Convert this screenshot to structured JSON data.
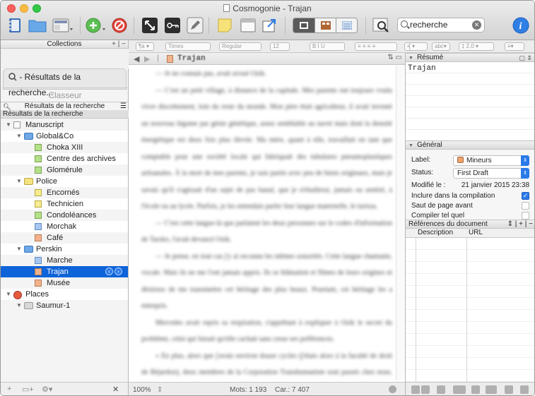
{
  "window": {
    "title": "Cosmogonie - Trajan"
  },
  "toolbar": {
    "search_value": "recherche",
    "icons": [
      "binder-icon",
      "folder-icon",
      "view-mode-icon",
      "add-icon",
      "delete-icon",
      "fullscreen-icon",
      "keywords-icon",
      "compose-icon",
      "note-icon",
      "snapshot-icon",
      "inspector-link-icon",
      "layout-icon",
      "corkboard-icon",
      "outline-icon",
      "search-icon",
      "info-icon"
    ]
  },
  "sidebar": {
    "header": "Collections",
    "collection_search": "- Résultats de la recherche...",
    "collection_binder": "Classeur",
    "filter_label": "Résultats de la recherche",
    "results_header": "Résultats de la recherche",
    "items": [
      {
        "label": "Manuscript",
        "level": 0,
        "icon": "manuscript-icon",
        "open": true
      },
      {
        "label": "Global&Co",
        "level": 1,
        "icon": "folder-blue-icon",
        "open": true
      },
      {
        "label": "Choka XIII",
        "level": 2,
        "icon": "doc-green-icon"
      },
      {
        "label": "Centre des archives",
        "level": 2,
        "icon": "doc-green-icon"
      },
      {
        "label": "Glomérule",
        "level": 2,
        "icon": "doc-green-icon"
      },
      {
        "label": "Police",
        "level": 1,
        "icon": "folder-yellow-icon",
        "open": true
      },
      {
        "label": "Encornés",
        "level": 2,
        "icon": "doc-yellow-icon"
      },
      {
        "label": "Technicien",
        "level": 2,
        "icon": "doc-yellow-icon"
      },
      {
        "label": "Condoléances",
        "level": 2,
        "icon": "doc-green-icon"
      },
      {
        "label": "Morchak",
        "level": 2,
        "icon": "doc-blue-icon"
      },
      {
        "label": "Café",
        "level": 2,
        "icon": "doc-orange-icon"
      },
      {
        "label": "Perskin",
        "level": 1,
        "icon": "folder-blue-icon",
        "open": true
      },
      {
        "label": "Marche",
        "level": 2,
        "icon": "doc-blue-icon"
      },
      {
        "label": "Trajan",
        "level": 2,
        "icon": "doc-orange-icon",
        "selected": true
      },
      {
        "label": "Musée",
        "level": 2,
        "icon": "doc-orange-icon"
      },
      {
        "label": "Places",
        "level": 0,
        "icon": "places-icon",
        "open": true
      },
      {
        "label": "Saumur-1",
        "level": 1,
        "icon": "folder-grey-icon",
        "open": true
      }
    ]
  },
  "editor": {
    "doc_title": "Trajan",
    "zoom": "100%",
    "words": "Mots: 1 193",
    "chars": "Car.: 7 407",
    "paragraphs": [
      "— Je ne connais pas, avait avoué Ozik.",
      "— C'est un petit village, à distance de la capitale. Mes parents ont toujours voulu vivre discrètement, loin du reste du monde. Mon père était agriculteur, il avait inventé un nouveau légume par génie génétique, assez semblable au navet mais dont la densité énergétique est deux fois plus élevée. Ma mère, quant à elle, travaillait en tant que comptable pour une société locale qui fabriquait des tubulures pneumoplastiques artisanales. À la mort de mes parents, je suis partie avec peu de biens originaux, mais je savais qu'il s'agissait d'un sujet de pas banal, que je n'étudierai, jamais ou sentiré, à l'école ou au lycée. Parfois, je les entendais parler leur langue maternelle, le turissa.",
      "— C'est cette langue-là que parlaient les deux personnes sur le codex d'information de Tarsko, l'avait devancé Ozik.",
      "— Je pense, en tout cas j'y ai reconnu les mêmes sonorités. Cette langue chantante, vocale. Mais ils ne me l'ont jamais appris. Ils se blâmaient et filmes de leurs origines ni désireux de me transmettre cet héritage des plus beaux. Pourtant, cet héritage les a entrepris.",
      "Mercedes avait repris sa respiration, s'apprêtant à expliquer à Ozik le secret du problème, celui qui faisait qu'elle cachait sans cesse ses préférences.",
      "« En plus, alors que j'avais environ douze cycles (j'étais alors à la faculté de droit de Béjardon), deux membres de la Corporation Transhumaniste sont passés chez nous. Mes parents avaient l'air moyennement heureux de les voir. J'ai implicitement compris que la"
    ]
  },
  "inspector": {
    "summary_header": "Résumé",
    "summary_text": "Trajan",
    "general_header": "Général",
    "label_key": "Label:",
    "label_value": "Mineurs",
    "label_color": "#f2a36b",
    "status_key": "Status:",
    "status_value": "First Draft",
    "modified_key": "Modifié le :",
    "modified_value": "21 janvier 2015 23:38",
    "include_label": "Inclure dans la compilation",
    "include_checked": true,
    "pagebreak_label": "Saut de page avant",
    "pagebreak_checked": false,
    "asis_label": "Compiler tel quel",
    "asis_checked": false,
    "refs_header": "Références du document",
    "refs_col_desc": "Description",
    "refs_col_url": "URL"
  },
  "colors": {
    "selection": "#0d63d8",
    "accent": "#2a7ae9"
  }
}
